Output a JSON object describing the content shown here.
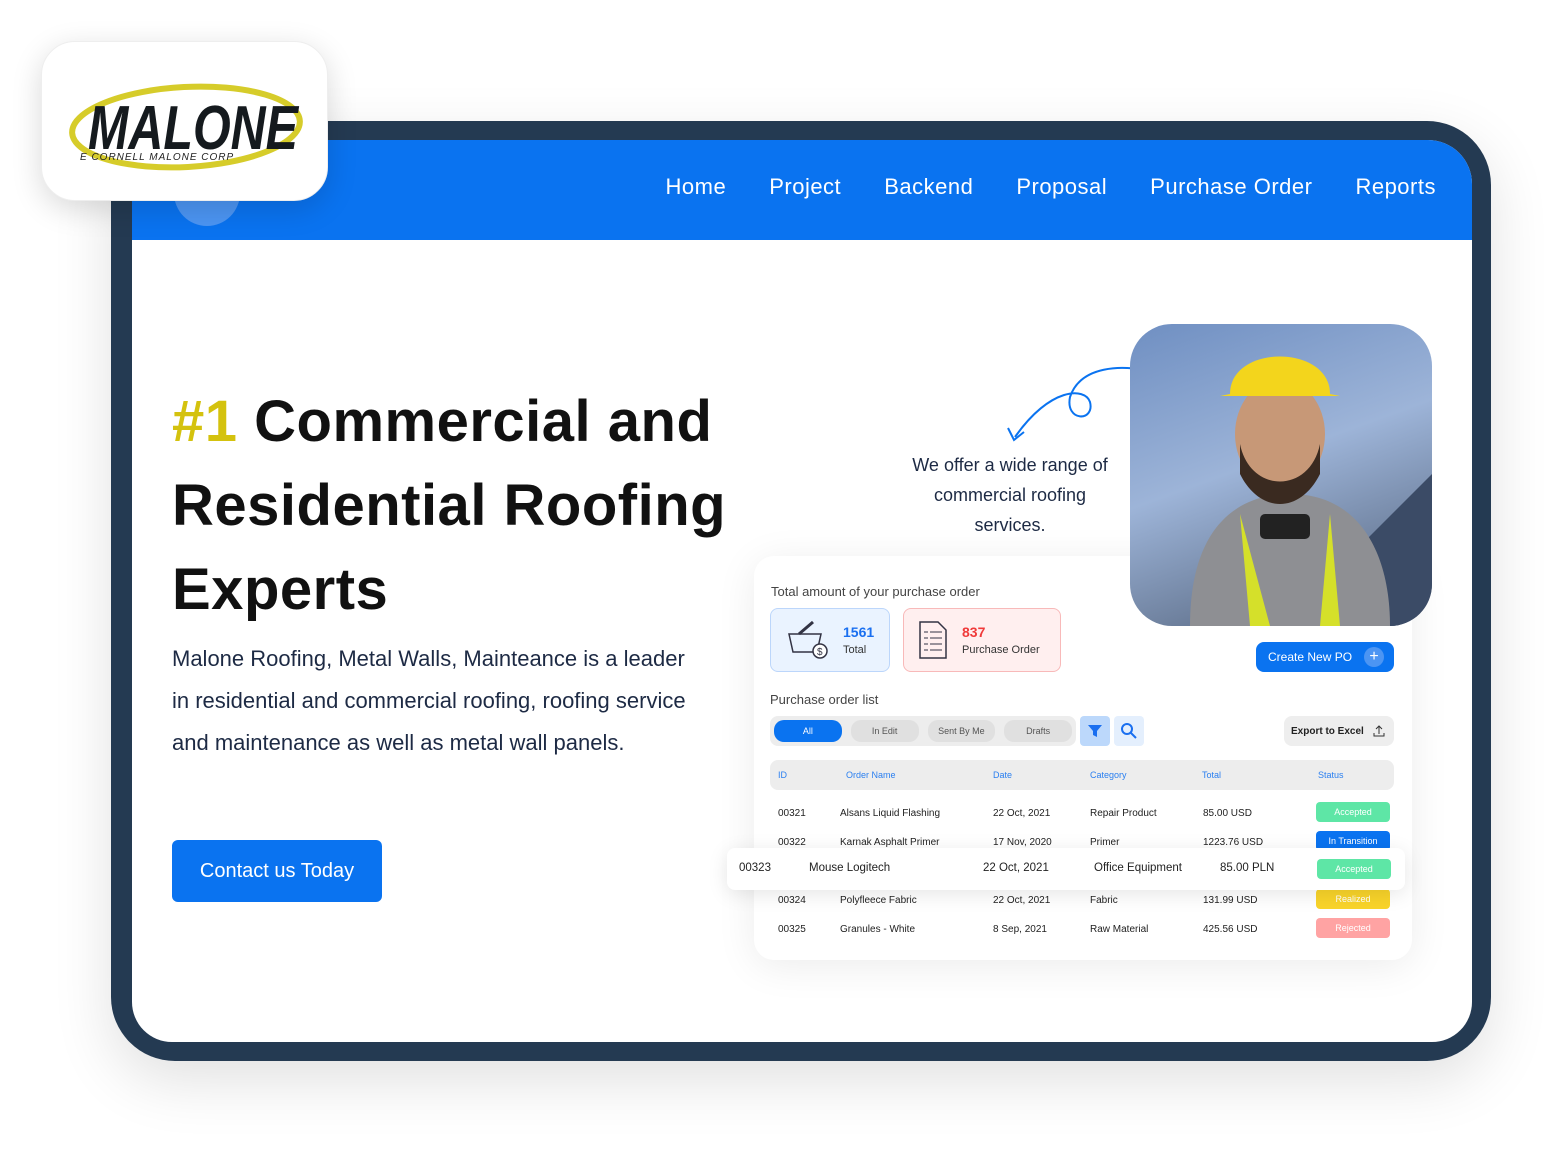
{
  "brand": {
    "logo_text": "MALONE",
    "logo_subtext": "E CORNELL MALONE CORP"
  },
  "nav": {
    "items": [
      "Home",
      "Project",
      "Backend",
      "Proposal",
      "Purchase Order",
      "Reports"
    ]
  },
  "hero": {
    "number": "#1",
    "title_rest": "Commercial and",
    "line2": "Residential Roofing",
    "line3": "Experts",
    "description": "Malone Roofing, Metal Walls, Mainteance is a leader in residential and commercial roofing, roofing service and maintenance as well as metal wall panels.",
    "cta": "Contact us Today"
  },
  "offer": "We offer a wide range of commercial roofing services.",
  "dashboard": {
    "summary_label": "Total amount of your purchase order",
    "stats": [
      {
        "value": "1561",
        "label": "Total",
        "color": "#1a6ff0"
      },
      {
        "value": "837",
        "label": "Purchase Order",
        "color": "#f03a3a"
      }
    ],
    "create_button": "Create New PO",
    "list_label": "Purchase order list",
    "tabs": [
      "All",
      "In Edit",
      "Sent By Me",
      "Drafts"
    ],
    "active_tab": "All",
    "export_button": "Export to Excel",
    "columns": [
      "ID",
      "Order Name",
      "Date",
      "Category",
      "Total",
      "Status"
    ],
    "rows": [
      {
        "id": "00321",
        "name": "Alsans Liquid Flashing",
        "date": "22 Oct, 2021",
        "category": "Repair Product",
        "total": "85.00 USD",
        "status": "Accepted"
      },
      {
        "id": "00322",
        "name": "Karnak Asphalt Primer",
        "date": "17 Nov, 2020",
        "category": "Primer",
        "total": "1223.76 USD",
        "status": "In Transition"
      },
      {
        "id": "00323",
        "name": "Mouse Logitech",
        "date": "22 Oct, 2021",
        "category": "Office Equipment",
        "total": "85.00 PLN",
        "status": "Accepted"
      },
      {
        "id": "00324",
        "name": "Polyfleece Fabric",
        "date": "22 Oct, 2021",
        "category": "Fabric",
        "total": "131.99 USD",
        "status": "Realized"
      },
      {
        "id": "00325",
        "name": "Granules - White",
        "date": "8 Sep, 2021",
        "category": "Raw Material",
        "total": "425.56 USD",
        "status": "Rejected"
      }
    ],
    "status_colors": {
      "Accepted": "#5ee6a6",
      "In Transition": "#0a73f0",
      "Realized": "#f9d42a",
      "Rejected": "#ffa3a3"
    }
  },
  "colors": {
    "primary": "#0a73f0",
    "frame": "#243a52",
    "accent": "#d4c20e"
  }
}
